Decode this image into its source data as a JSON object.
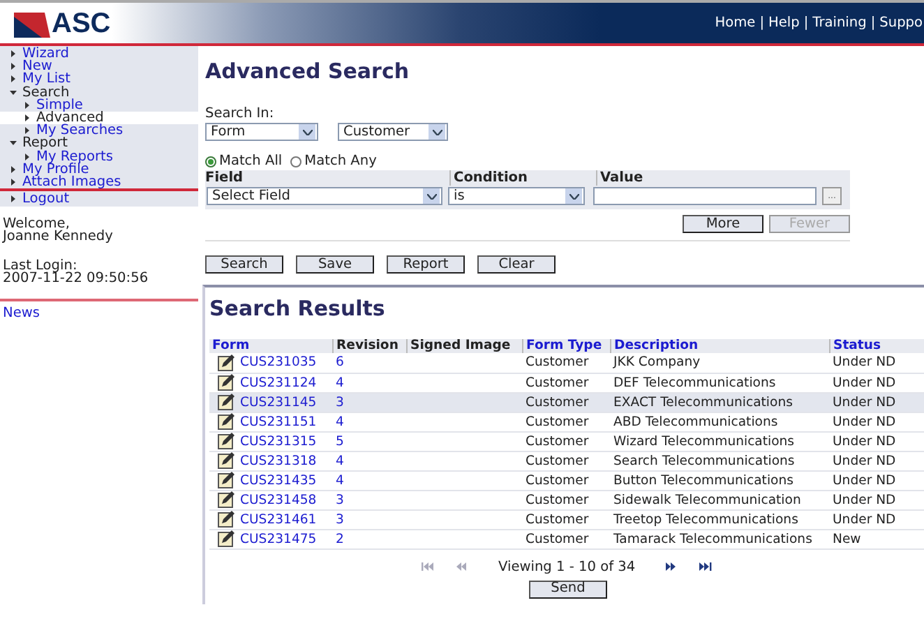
{
  "header": {
    "logo": "ASC",
    "separator": "|",
    "links": [
      {
        "label": "Home"
      },
      {
        "label": "Help"
      },
      {
        "label": "Training"
      },
      {
        "label": "Suppo"
      }
    ]
  },
  "sidebar": {
    "items": [
      {
        "label": "Wizard",
        "expanded": false,
        "selected": false
      },
      {
        "label": "New",
        "expanded": false,
        "selected": false
      },
      {
        "label": "My List",
        "expanded": false,
        "selected": false
      },
      {
        "label": "Search",
        "expanded": true,
        "selected": false,
        "children": [
          {
            "label": "Simple",
            "selected": false
          },
          {
            "label": "Advanced",
            "selected": true
          },
          {
            "label": "My Searches",
            "selected": false
          }
        ]
      },
      {
        "label": "Report",
        "expanded": true,
        "selected": false,
        "children": [
          {
            "label": "My Reports",
            "selected": false
          }
        ]
      },
      {
        "label": "My Profile",
        "expanded": false,
        "selected": false
      },
      {
        "label": "Attach Images",
        "expanded": false,
        "selected": false
      }
    ],
    "logout": "Logout",
    "welcome": "Welcome,",
    "user": "Joanne Kennedy",
    "last_login_label": "Last Login:",
    "last_login": "2007-11-22 09:50:56",
    "news": "News"
  },
  "search": {
    "title": "Advanced Search",
    "search_in_label": "Search In:",
    "search_in": [
      "Form",
      "Customer"
    ],
    "match": [
      {
        "label": "Match All",
        "selected": true
      },
      {
        "label": "Match Any",
        "selected": false
      }
    ],
    "criteria_columns": [
      "Field",
      "Condition",
      "Value"
    ],
    "criteria": {
      "field": "Select Field",
      "condition": "is",
      "browse": "..."
    },
    "row_buttons": [
      {
        "label": "More",
        "disabled": false
      },
      {
        "label": "Fewer",
        "disabled": true
      }
    ],
    "actions": [
      "Search",
      "Save",
      "Report",
      "Clear"
    ]
  },
  "results": {
    "title": "Search Results",
    "columns": [
      {
        "label": "Form",
        "link": true
      },
      {
        "label": "Revision",
        "link": false
      },
      {
        "label": "Signed Image",
        "link": false
      },
      {
        "label": "Form Type",
        "link": true
      },
      {
        "label": "Description",
        "link": true
      },
      {
        "label": "Status",
        "link": true
      }
    ],
    "rows": [
      {
        "form": "CUS231035",
        "revision": "6",
        "type": "Customer",
        "description": "JKK Company",
        "status": "Under ND",
        "selected": false
      },
      {
        "form": "CUS231124",
        "revision": "4",
        "type": "Customer",
        "description": "DEF Telecommunications",
        "status": "Under ND",
        "selected": false
      },
      {
        "form": "CUS231145",
        "revision": "3",
        "type": "Customer",
        "description": "EXACT Telecommunications",
        "status": "Under ND",
        "selected": true
      },
      {
        "form": "CUS231151",
        "revision": "4",
        "type": "Customer",
        "description": "ABD Telecommunications",
        "status": "Under ND",
        "selected": false
      },
      {
        "form": "CUS231315",
        "revision": "5",
        "type": "Customer",
        "description": "Wizard Telecommunications",
        "status": "Under ND",
        "selected": false
      },
      {
        "form": "CUS231318",
        "revision": "4",
        "type": "Customer",
        "description": "Search Telecommunications",
        "status": "Under ND",
        "selected": false
      },
      {
        "form": "CUS231435",
        "revision": "4",
        "type": "Customer",
        "description": "Button Telecommunications",
        "status": "Under ND",
        "selected": false
      },
      {
        "form": "CUS231458",
        "revision": "3",
        "type": "Customer",
        "description": "Sidewalk Telecommunication",
        "status": "Under ND",
        "selected": false
      },
      {
        "form": "CUS231461",
        "revision": "3",
        "type": "Customer",
        "description": "Treetop Telecommunications",
        "status": "Under ND",
        "selected": false
      },
      {
        "form": "CUS231475",
        "revision": "2",
        "type": "Customer",
        "description": "Tamarack Telecommunications",
        "status": "New",
        "selected": false
      }
    ],
    "pager": {
      "first_disabled": true,
      "prev_disabled": true,
      "next_disabled": false,
      "last_disabled": false,
      "text": "Viewing 1 - 10 of 34"
    },
    "send": "Send"
  }
}
